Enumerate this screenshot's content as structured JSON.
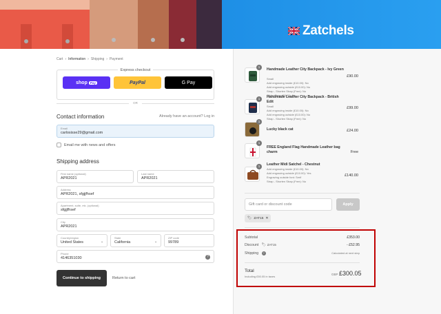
{
  "brand": {
    "name": "Zatchels"
  },
  "breadcrumb": [
    "Cart",
    "Information",
    "Shipping",
    "Payment"
  ],
  "express": {
    "title": "Express checkout",
    "shoppay": "shop",
    "shoppay_pill": "Pay",
    "paypal": "PayPal",
    "gpay": "G Pay",
    "or": "OR"
  },
  "contact": {
    "title": "Contact information",
    "login_prompt": "Already have an account?",
    "login_link": "Log in",
    "email_label": "Email",
    "email_value": "carlosisse29@gmail.com",
    "newsletter": "Email me with news and offers"
  },
  "shipping": {
    "title": "Shipping address",
    "first_name_label": "First name (optional)",
    "first_name": "APR2021",
    "last_name_label": "Last name",
    "last_name": "APR2021",
    "address_label": "Address",
    "address": "APR2021, sfgjjfhsef",
    "apt_label": "Apartment, suite, etc. (optional)",
    "apt": "sfgjjfhsef",
    "city_label": "City",
    "city": "APR2021",
    "country_label": "Country/region",
    "country": "United States",
    "state_label": "State",
    "state": "California",
    "zip_label": "ZIP code",
    "zip": "99789",
    "phone_label": "Phone",
    "phone": "4146351030"
  },
  "actions": {
    "continue": "Continue to shipping",
    "return": "Return to cart"
  },
  "items": [
    {
      "qty": "1",
      "name": "Handmade Leather City Backpack - Ivy Green",
      "desc": [
        "Small",
        "Add engraving inside (£10.00): No",
        "Add engraving outside (£10.00): No",
        "Strap - Shorten Strap (Free): No",
        "Slider Strap (£0.00): No"
      ],
      "price": "£90.00"
    },
    {
      "qty": "1",
      "name": "Handmade Leather City Backpack - British Edit",
      "desc": [
        "Small",
        "Add engraving inside (£10.00): No",
        "Add engraving outside (£10.00): No",
        "Strap - Shorten Strap (Free): No"
      ],
      "price": "£99.00"
    },
    {
      "qty": "1",
      "name": "Lucky black cat",
      "desc": [],
      "price": "£24.00"
    },
    {
      "qty": "1",
      "name": "FREE England Flag Handmade Leather bag charm",
      "desc": [],
      "price": "Free"
    },
    {
      "qty": "1",
      "name": "Leather Midi Satchel - Chestnut",
      "desc": [
        "Add engraving inside (£10.00): No",
        "Add engraving outside (£10.00): Yes",
        "Engraving outside font: Serif",
        "Strap - Shorten Strap (Free): No"
      ],
      "price": "£140.00"
    }
  ],
  "discount": {
    "placeholder": "Gift card or discount code",
    "apply": "Apply",
    "code": "ZAT15"
  },
  "summary": {
    "subtotal_label": "Subtotal",
    "subtotal": "£353.00",
    "discount_label": "Discount",
    "discount_code": "ZAT15",
    "discount": "- £52.95",
    "shipping_label": "Shipping",
    "shipping": "Calculated at next step",
    "total_label": "Total",
    "total_sub": "Including £50.05 in taxes",
    "currency": "GBP",
    "total": "£300.05"
  },
  "colors": {
    "accent": "#333333",
    "brand_blue": "#2a9ff0",
    "highlight": "#c00000",
    "shoppay": "#5a31f4",
    "paypal": "#ffc439"
  }
}
